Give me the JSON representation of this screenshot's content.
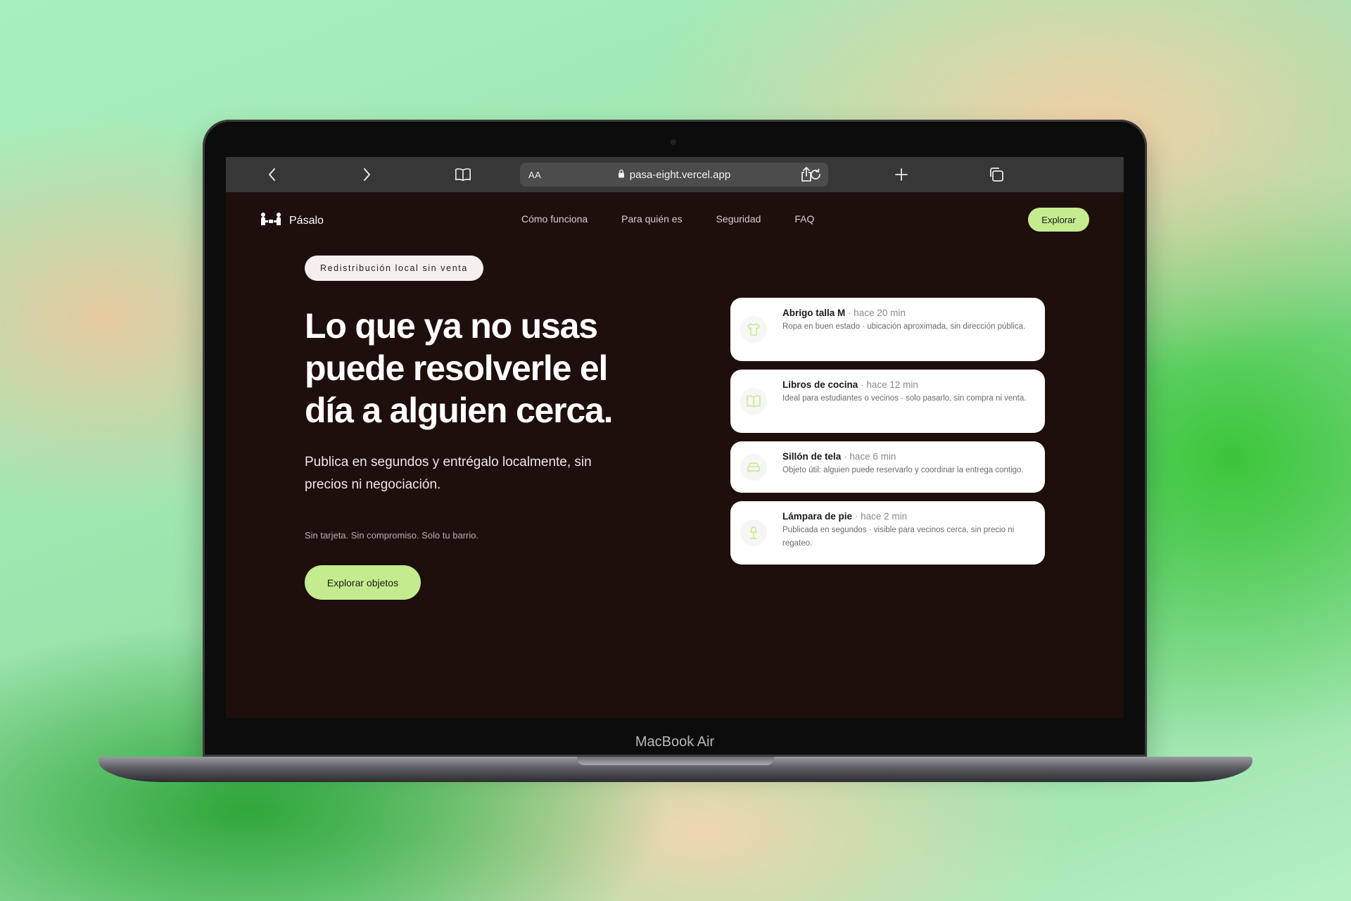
{
  "browser": {
    "text_size_label": "AA",
    "url": "pasa-eight.vercel.app"
  },
  "site": {
    "brand": "Pásalo",
    "nav": [
      "Cómo funciona",
      "Para quién es",
      "Seguridad",
      "FAQ"
    ],
    "explore_button": "Explorar"
  },
  "hero": {
    "badge": "Redistribución local sin venta",
    "headline": "Lo que ya no usas puede resolverle el día a alguien cerca.",
    "subtitle": "Publica en segundos y entrégalo localmente, sin precios ni negociación.",
    "note": "Sin tarjeta. Sin compromiso. Solo tu barrio.",
    "cta": "Explorar objetos"
  },
  "listings": [
    {
      "title": "Abrigo talla M",
      "time": "hace 20 min",
      "description": "Ropa en buen estado · ubicación aproximada, sin dirección pública.",
      "icon": "shirt-icon"
    },
    {
      "title": "Libros de cocina",
      "time": "hace 12 min",
      "description": "Ideal para estudiantes o vecinos · solo pasarlo, sin compra ni venta.",
      "icon": "book-icon"
    },
    {
      "title": "Sillón de tela",
      "time": "hace 6 min",
      "description": "Objeto útil: alguien puede reservarlo y coordinar la entrega contigo.",
      "icon": "sofa-icon"
    },
    {
      "title": "Lámpara de pie",
      "time": "hace 2 min",
      "description": "Publicada en segundos · visible para vecinos cerca, sin precio ni regateo.",
      "icon": "lamp-icon"
    }
  ],
  "device_label": "MacBook Air",
  "colors": {
    "page_background": "#1e0e0c",
    "accent": "#c4ec8f",
    "browser_bar": "#373737"
  }
}
